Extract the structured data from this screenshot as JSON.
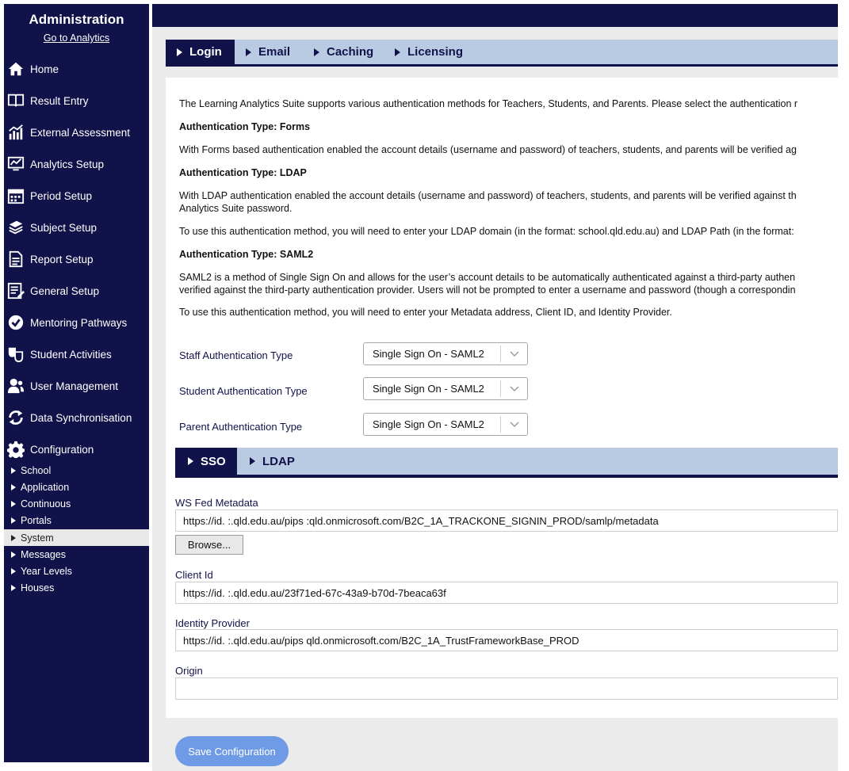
{
  "sidebar": {
    "title": "Administration",
    "analytics_link": "Go to Analytics",
    "items": [
      {
        "label": "Home",
        "icon": "home-icon"
      },
      {
        "label": "Result Entry",
        "icon": "book-icon"
      },
      {
        "label": "External Assessment",
        "icon": "chart-icon"
      },
      {
        "label": "Analytics Setup",
        "icon": "monitor-chart-icon"
      },
      {
        "label": "Period Setup",
        "icon": "calendar-icon"
      },
      {
        "label": "Subject Setup",
        "icon": "books-icon"
      },
      {
        "label": "Report Setup",
        "icon": "report-icon"
      },
      {
        "label": "General Setup",
        "icon": "list-edit-icon"
      },
      {
        "label": "Mentoring Pathways",
        "icon": "check-badge-icon"
      },
      {
        "label": "Student Activities",
        "icon": "masks-icon"
      },
      {
        "label": "User Management",
        "icon": "users-icon"
      },
      {
        "label": "Data Synchronisation",
        "icon": "sync-icon"
      },
      {
        "label": "Configuration",
        "icon": "gear-icon"
      }
    ],
    "sub_items": [
      {
        "label": "School"
      },
      {
        "label": "Application"
      },
      {
        "label": "Continuous"
      },
      {
        "label": "Portals"
      },
      {
        "label": "System"
      },
      {
        "label": "Messages"
      },
      {
        "label": "Year Levels"
      },
      {
        "label": "Houses"
      }
    ],
    "active_sub": "System"
  },
  "tabs": [
    {
      "label": "Login",
      "active": true
    },
    {
      "label": "Email",
      "active": false
    },
    {
      "label": "Caching",
      "active": false
    },
    {
      "label": "Licensing",
      "active": false
    }
  ],
  "content": {
    "intro": "The Learning Analytics Suite supports various authentication methods for Teachers, Students, and Parents. Please select the authentication r",
    "forms_heading": "Authentication Type: Forms",
    "forms_text": "With Forms based authentication enabled the account details (username and password) of teachers, students, and parents will be verified ag",
    "ldap_heading": "Authentication Type: LDAP",
    "ldap_text_1": "With LDAP authentication enabled the account details (username and password) of teachers, students, and parents will be verified against th",
    "ldap_text_2": "Analytics Suite password.",
    "ldap_text_3": "To use this authentication method, you will need to enter your LDAP domain (in the format: school.qld.edu.au) and LDAP Path (in the format:",
    "saml_heading": "Authentication Type: SAML2",
    "saml_text_1": "SAML2 is a method of Single Sign On and allows for the user’s account details to be automatically authenticated against a third-party authen",
    "saml_text_2": "verified against the third-party authentication provider. Users will not be prompted to enter a username and password (though a correspondin",
    "saml_text_3": "To use this authentication method, you will need to enter your Metadata address, Client ID, and Identity Provider."
  },
  "auth_fields": {
    "staff_label": "Staff Authentication Type",
    "staff_value": "Single Sign On - SAML2",
    "student_label": "Student Authentication Type",
    "student_value": "Single Sign On - SAML2",
    "parent_label": "Parent Authentication Type",
    "parent_value": "Single Sign On - SAML2"
  },
  "sub_tabs": [
    {
      "label": "SSO",
      "active": true
    },
    {
      "label": "LDAP",
      "active": false
    }
  ],
  "sso": {
    "metadata_label": "WS Fed Metadata",
    "metadata_value": "https://id.    :.qld.edu.au/pips     :qld.onmicrosoft.com/B2C_1A_TRACKONE_SIGNIN_PROD/samlp/metadata",
    "browse_label": "Browse...",
    "client_id_label": "Client Id",
    "client_id_value": "https://id.    :.qld.edu.au/23f71ed-67c-43a9-b70d-7beaca63f",
    "identity_label": "Identity Provider",
    "identity_value": "https://id.    :.qld.edu.au/pips     qld.onmicrosoft.com/B2C_1A_TrustFrameworkBase_PROD",
    "origin_label": "Origin",
    "origin_value": ""
  },
  "save_label": "Save Configuration",
  "colors": {
    "navy": "#12124a",
    "tab_bg": "#b9cbe3",
    "save_button": "#6f9be6",
    "panel_bg": "#ebebeb"
  }
}
